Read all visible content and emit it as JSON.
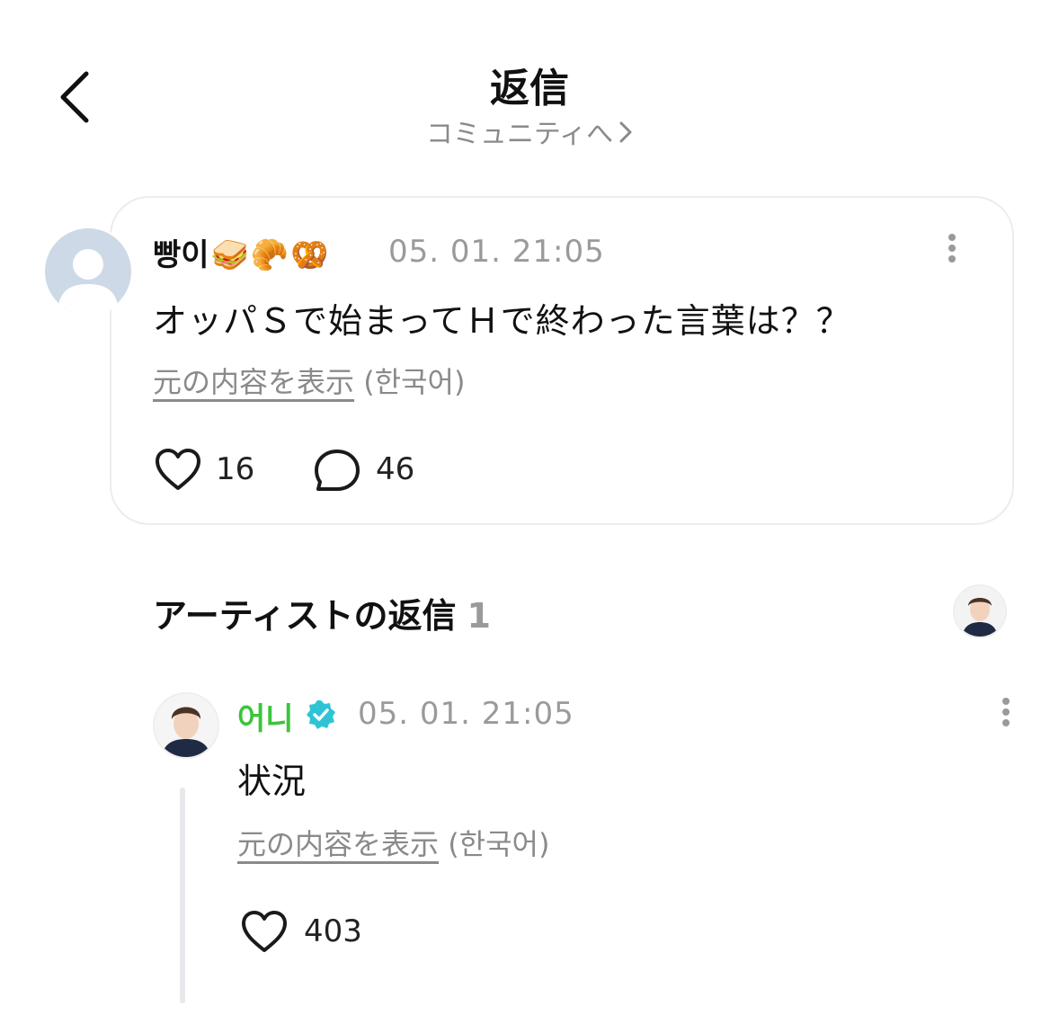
{
  "header": {
    "title": "返信",
    "subtitle": "コミュニティへ"
  },
  "post": {
    "author": "빵이",
    "emojis": [
      "🥪",
      "🥐",
      "🥨"
    ],
    "date": "05. 01. 21:05",
    "text": "オッパＳで始まってＨで終わった言葉は？？",
    "translate_link": "元の内容を表示",
    "translate_lang": "(한국어)",
    "likes": "16",
    "comments": "46"
  },
  "artist_section": {
    "title": "アーティストの返信",
    "count": "1"
  },
  "reply": {
    "author": "어니",
    "date": "05. 01. 21:05",
    "text": "状況",
    "translate_link": "元の内容を表示",
    "translate_lang": "(한국어)",
    "likes": "403"
  },
  "colors": {
    "artist_name": "#3cc43c",
    "verified_badge": "#2ec4d6",
    "muted": "#9a9a9a"
  }
}
